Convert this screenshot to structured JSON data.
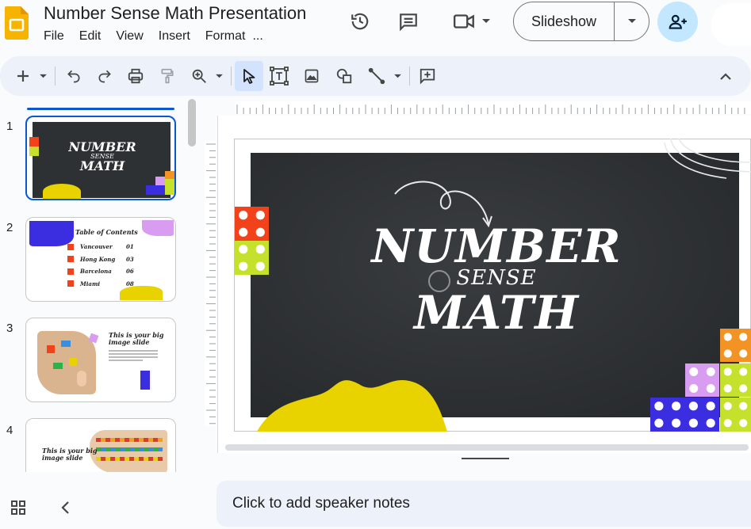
{
  "app": {
    "title": "Number Sense Math Presentation"
  },
  "menu": [
    "File",
    "Edit",
    "View",
    "Insert",
    "Format",
    "..."
  ],
  "header": {
    "slideshow_label": "Slideshow"
  },
  "filmstrip": {
    "numbers": [
      "1",
      "2",
      "3",
      "4"
    ],
    "slide1": {
      "line1": "NUMBER",
      "line2": "SENSE",
      "line3": "MATH"
    },
    "slide2": {
      "heading": "Table of Contents",
      "rows": [
        {
          "name": "Vancouver",
          "num": "01"
        },
        {
          "name": "Hong Kong",
          "num": "03"
        },
        {
          "name": "Barcelona",
          "num": "06"
        },
        {
          "name": "Miami",
          "num": "08"
        }
      ]
    },
    "slide3": {
      "heading_line1": "This is your big",
      "heading_line2": "image slide"
    },
    "slide4": {
      "heading_line1": "This is your big",
      "heading_line2": "image slide"
    }
  },
  "slide": {
    "line1": "NUMBER",
    "line2": "SENSE",
    "line3": "MATH"
  },
  "notes": {
    "placeholder": "Click to add speaker notes"
  },
  "colors": {
    "chalkboard": "#2e3133",
    "yellow": "#e8d200",
    "red": "#f2421b",
    "lime": "#c6e12b",
    "orange": "#f39323",
    "lilac": "#d89cf0",
    "blue": "#3a2ee0",
    "accent": "#0b57d0"
  }
}
